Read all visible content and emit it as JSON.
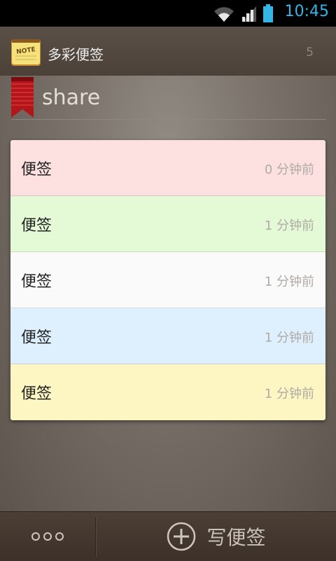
{
  "status_bar": {
    "time": "10:45",
    "icons": [
      "wifi-icon",
      "signal-icon",
      "battery-icon"
    ],
    "accent_color": "#34b5e5"
  },
  "app_bar": {
    "title": "多彩便签",
    "note_count": "5",
    "icon": "note-pad-icon",
    "icon_text": "NOTE"
  },
  "folder": {
    "name": "share",
    "icon": "bookmark-ribbon-icon"
  },
  "notes": [
    {
      "title": "便签",
      "time": "0 分钟前",
      "color": "#fde0e0"
    },
    {
      "title": "便签",
      "time": "1 分钟前",
      "color": "#e4fad6"
    },
    {
      "title": "便签",
      "time": "1 分钟前",
      "color": "#fafafa"
    },
    {
      "title": "便签",
      "time": "1 分钟前",
      "color": "#def0fd"
    },
    {
      "title": "便签",
      "time": "1 分钟前",
      "color": "#fdf5c2"
    }
  ],
  "bottom_bar": {
    "more_icon": "more-dots-icon",
    "write_icon": "plus-circle-icon",
    "write_label": "写便签"
  }
}
